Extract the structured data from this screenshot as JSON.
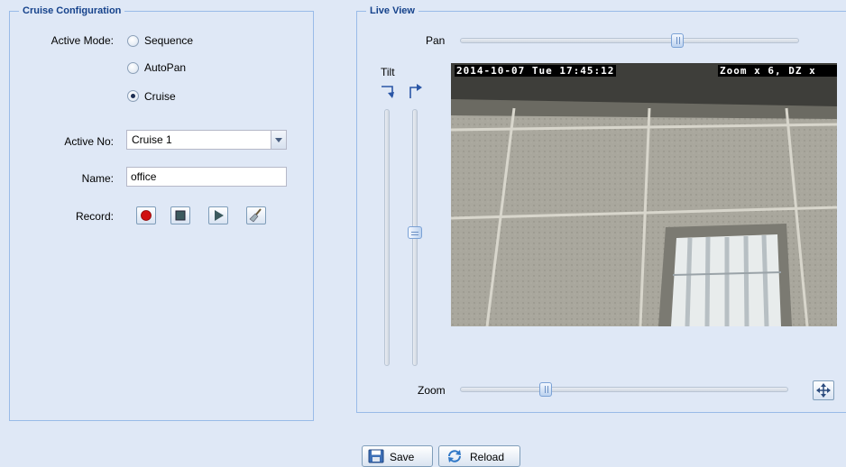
{
  "cruise_config": {
    "legend": "Cruise Configuration",
    "active_mode_label": "Active Mode:",
    "modes": [
      {
        "label": "Sequence",
        "checked": false
      },
      {
        "label": "AutoPan",
        "checked": false
      },
      {
        "label": "Cruise",
        "checked": true
      }
    ],
    "active_no_label": "Active No:",
    "active_no_value": "Cruise 1",
    "name_label": "Name:",
    "name_value": "office",
    "record_label": "Record:",
    "record_buttons": [
      "record-icon",
      "stop-icon",
      "play-icon",
      "clear-icon"
    ]
  },
  "live_view": {
    "legend": "Live View",
    "pan_label": "Pan",
    "tilt_label": "Tilt",
    "zoom_label": "Zoom",
    "osd_left": "2014-10-07 Tue 17:45:12",
    "osd_right": "Zoom x 6, DZ x",
    "pan_level_fraction": 0.63,
    "tilt_level_fraction": 0.48,
    "zoom_level_fraction": 0.26
  },
  "footer": {
    "save_label": "Save",
    "reload_label": "Reload"
  },
  "colors": {
    "background": "#dfe8f6",
    "legend_text": "#15428b",
    "border": "#99bbe8",
    "record_red": "#d01010"
  }
}
